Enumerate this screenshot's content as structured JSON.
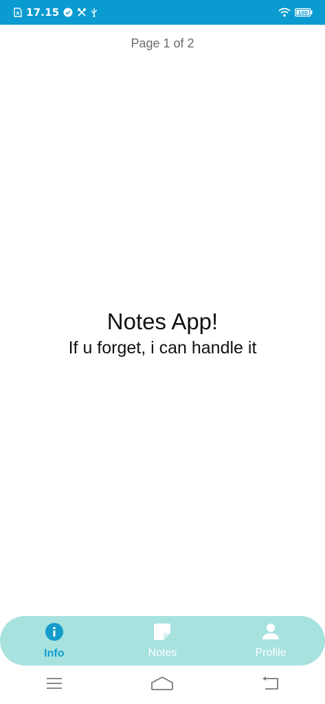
{
  "status_bar": {
    "time": "17.15",
    "battery": "100",
    "background": "#0a9bd1"
  },
  "pager": {
    "text": "Page 1 of 2"
  },
  "content": {
    "title": "Notes App!",
    "subtitle": "If u forget, i can handle it"
  },
  "bottom_nav": {
    "background": "#a7e2df",
    "active_color": "#139ccc",
    "items": [
      {
        "label": "Info",
        "icon": "info-icon",
        "active": true
      },
      {
        "label": "Notes",
        "icon": "note-icon",
        "active": false
      },
      {
        "label": "Profile",
        "icon": "person-icon",
        "active": false
      }
    ]
  },
  "system_nav": {
    "buttons": [
      "menu-icon",
      "home-icon",
      "back-icon"
    ]
  }
}
